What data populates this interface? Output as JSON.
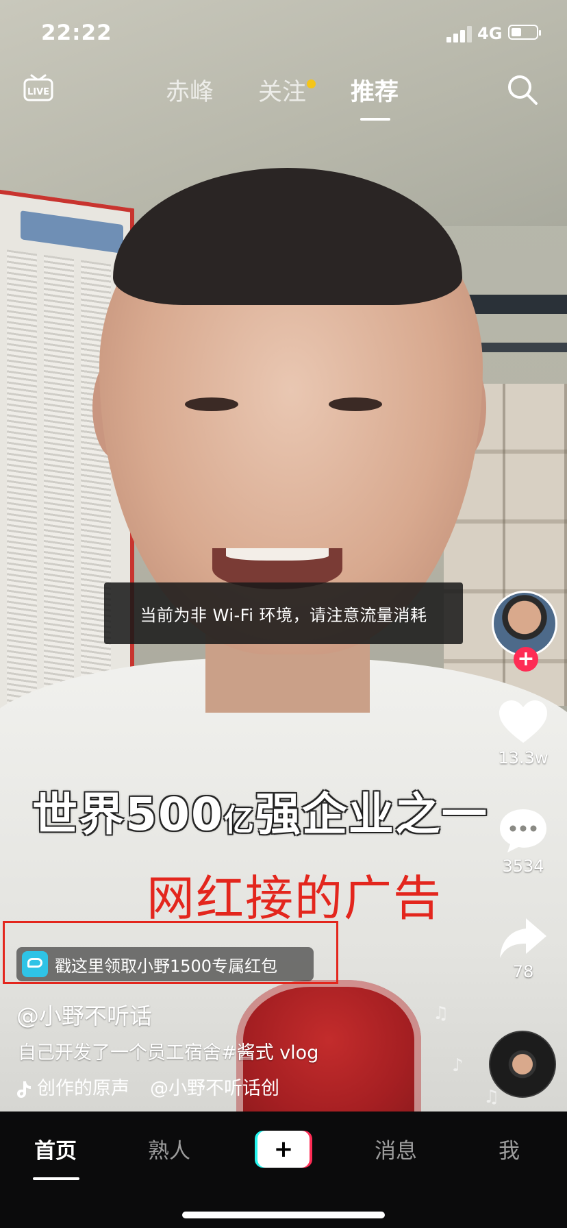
{
  "status_bar": {
    "time": "22:22",
    "network": "4G"
  },
  "top_nav": {
    "tabs": [
      {
        "label": "赤峰",
        "active": false
      },
      {
        "label": "关注",
        "active": false,
        "has_dot": true
      },
      {
        "label": "推荐",
        "active": true
      }
    ],
    "dot_color": "#f5c518"
  },
  "toast": {
    "text": "当前为非 Wi-Fi 环境，请注意流量消耗"
  },
  "video": {
    "subtitle_main": "世界500",
    "subtitle_small": "亿",
    "subtitle_rest": "强企业之一",
    "annotation": "网红接的广告",
    "annotation_color": "#e3261d"
  },
  "ad": {
    "text": "戳这里领取小野1500专属红包",
    "logo_color": "#2fc3e6"
  },
  "rail": {
    "like_count": "13.3w",
    "comment_count": "3534",
    "share_count": "78",
    "follow_label": "+",
    "accent": "#fe2c55"
  },
  "caption": {
    "author": "@小野不听话",
    "description": "自己开发了一个员工宿舍#酱式 vlog",
    "music_prefix": "创作的原声",
    "music_author": "@小野不听话创"
  },
  "bottom_nav": {
    "items": [
      {
        "label": "首页",
        "active": true
      },
      {
        "label": "熟人",
        "active": false
      },
      {
        "label": "+",
        "active": false
      },
      {
        "label": "消息",
        "active": false
      },
      {
        "label": "我",
        "active": false
      }
    ]
  }
}
